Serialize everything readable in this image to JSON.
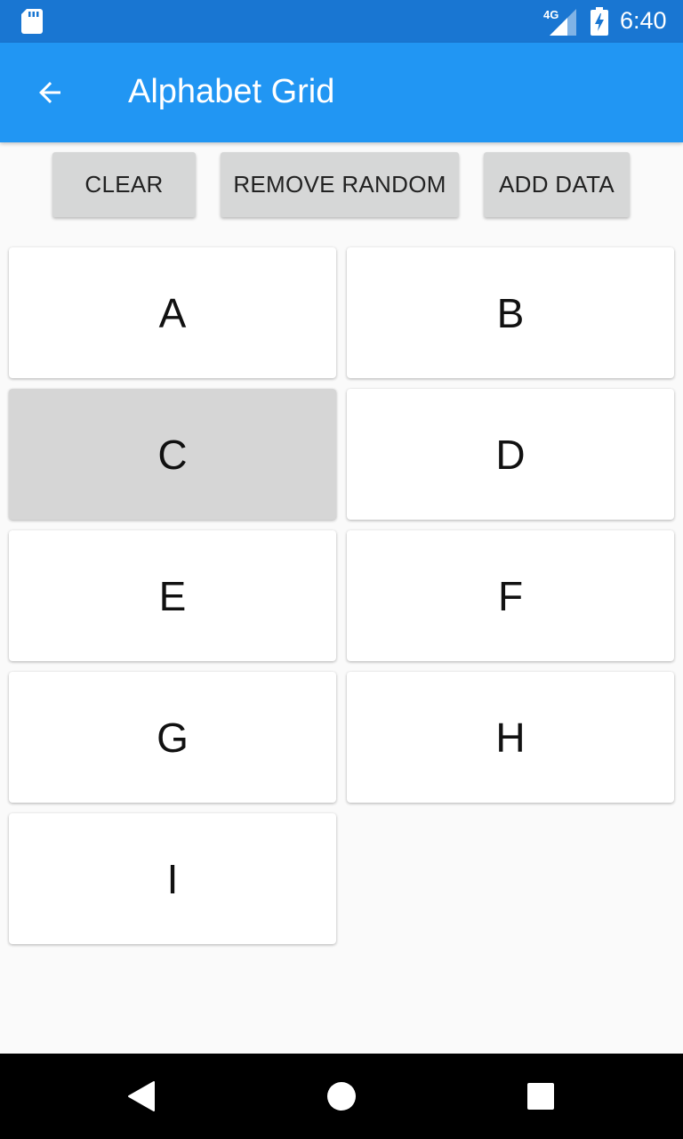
{
  "status_bar": {
    "network": "4G",
    "time": "6:40",
    "icons": [
      "sd-card-icon",
      "signal-icon",
      "battery-charging-icon"
    ]
  },
  "app_bar": {
    "title": "Alphabet Grid",
    "back_icon": "arrow-back-icon",
    "color": "#2196f3"
  },
  "actions": {
    "clear": "CLEAR",
    "remove_random": "REMOVE RANDOM",
    "add_data": "ADD DATA"
  },
  "grid": {
    "items": [
      "A",
      "B",
      "C",
      "D",
      "E",
      "F",
      "G",
      "H",
      "I"
    ],
    "selected": "C"
  },
  "nav": {
    "icons": [
      "back-triangle-icon",
      "home-circle-icon",
      "recents-square-icon"
    ]
  }
}
